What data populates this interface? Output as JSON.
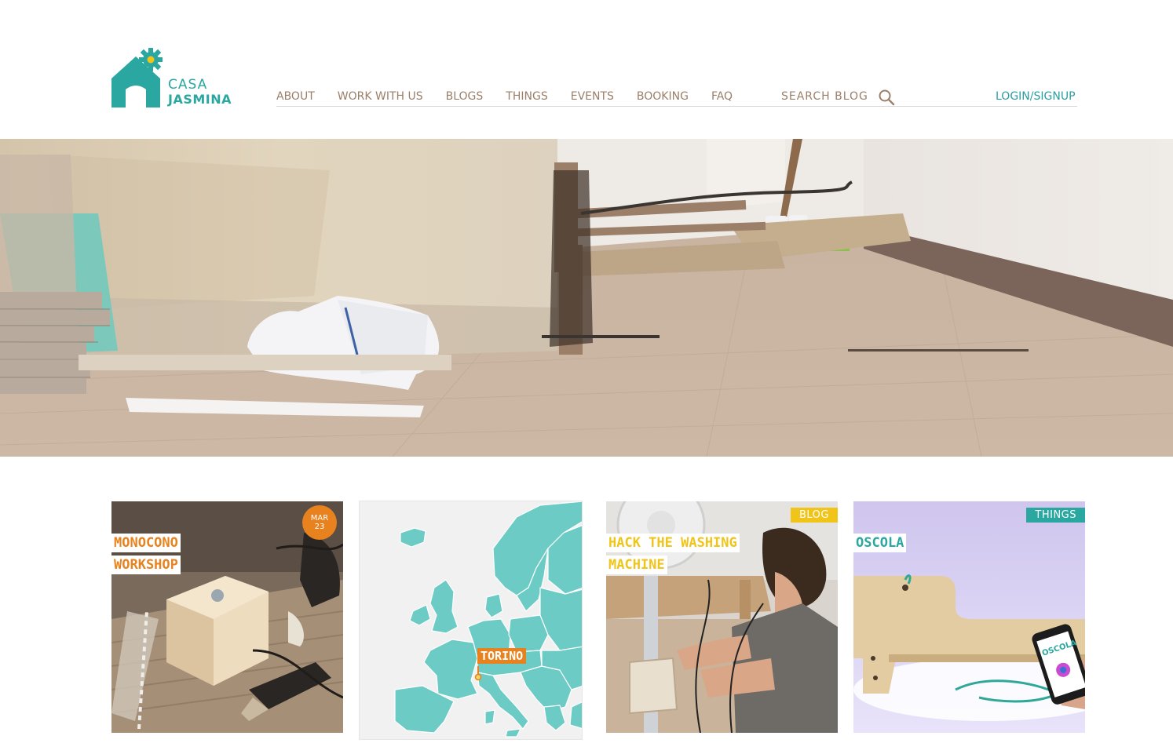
{
  "logo": {
    "line1": "CASA",
    "line2": "JASMINA"
  },
  "nav": {
    "items": [
      "ABOUT",
      "WORK WITH US",
      "BLOGS",
      "THINGS",
      "EVENTS",
      "BOOKING",
      "FAQ"
    ]
  },
  "search": {
    "placeholder": "SEARCH BLOG",
    "icon": "magnifier-icon"
  },
  "login_label": "LOGIN/SIGNUP",
  "colors": {
    "teal": "#2aa7a0",
    "orange": "#e8821e",
    "yellow": "#f0c419",
    "nav_text": "#9a7f6a"
  },
  "cards": [
    {
      "title_lines": [
        "MONOCONO",
        "WORKSHOP"
      ],
      "date_month": "MAR",
      "date_day": "23"
    },
    {
      "map_label": "TORINO"
    },
    {
      "title_lines": [
        "HACK THE WASHING",
        "MACHINE"
      ],
      "tag": "BLOG"
    },
    {
      "title_lines": [
        "OSCOLA"
      ],
      "tag": "THINGS",
      "phone_text": "OSCOLA"
    }
  ]
}
